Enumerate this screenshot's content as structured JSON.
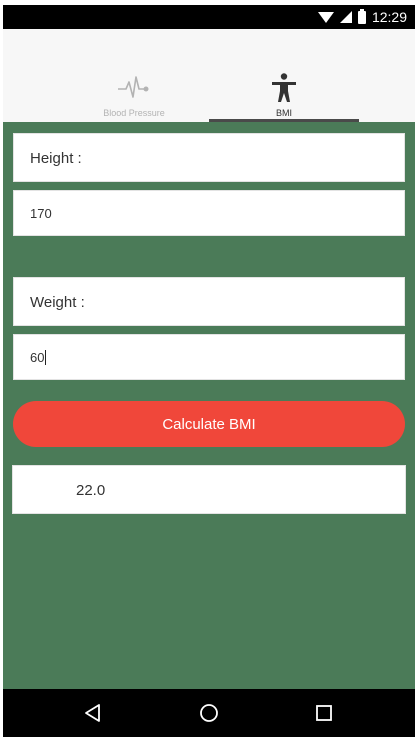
{
  "status_bar": {
    "time": "12:29"
  },
  "tabs": [
    {
      "label": "Blood Pressure",
      "icon": "heartbeat-icon",
      "selected": false
    },
    {
      "label": "BMI",
      "icon": "person-icon",
      "selected": true
    }
  ],
  "height": {
    "label": "Height :",
    "value": "170"
  },
  "weight": {
    "label": "Weight :",
    "value": "60"
  },
  "calculate_button": {
    "label": "Calculate BMI"
  },
  "result": {
    "value": "22.0"
  },
  "colors": {
    "background": "#4b7b58",
    "button": "#f0473a",
    "tab_header": "#f7f7f7"
  },
  "nav_bar": {
    "icons": [
      "back-icon",
      "home-icon",
      "recents-icon"
    ]
  }
}
